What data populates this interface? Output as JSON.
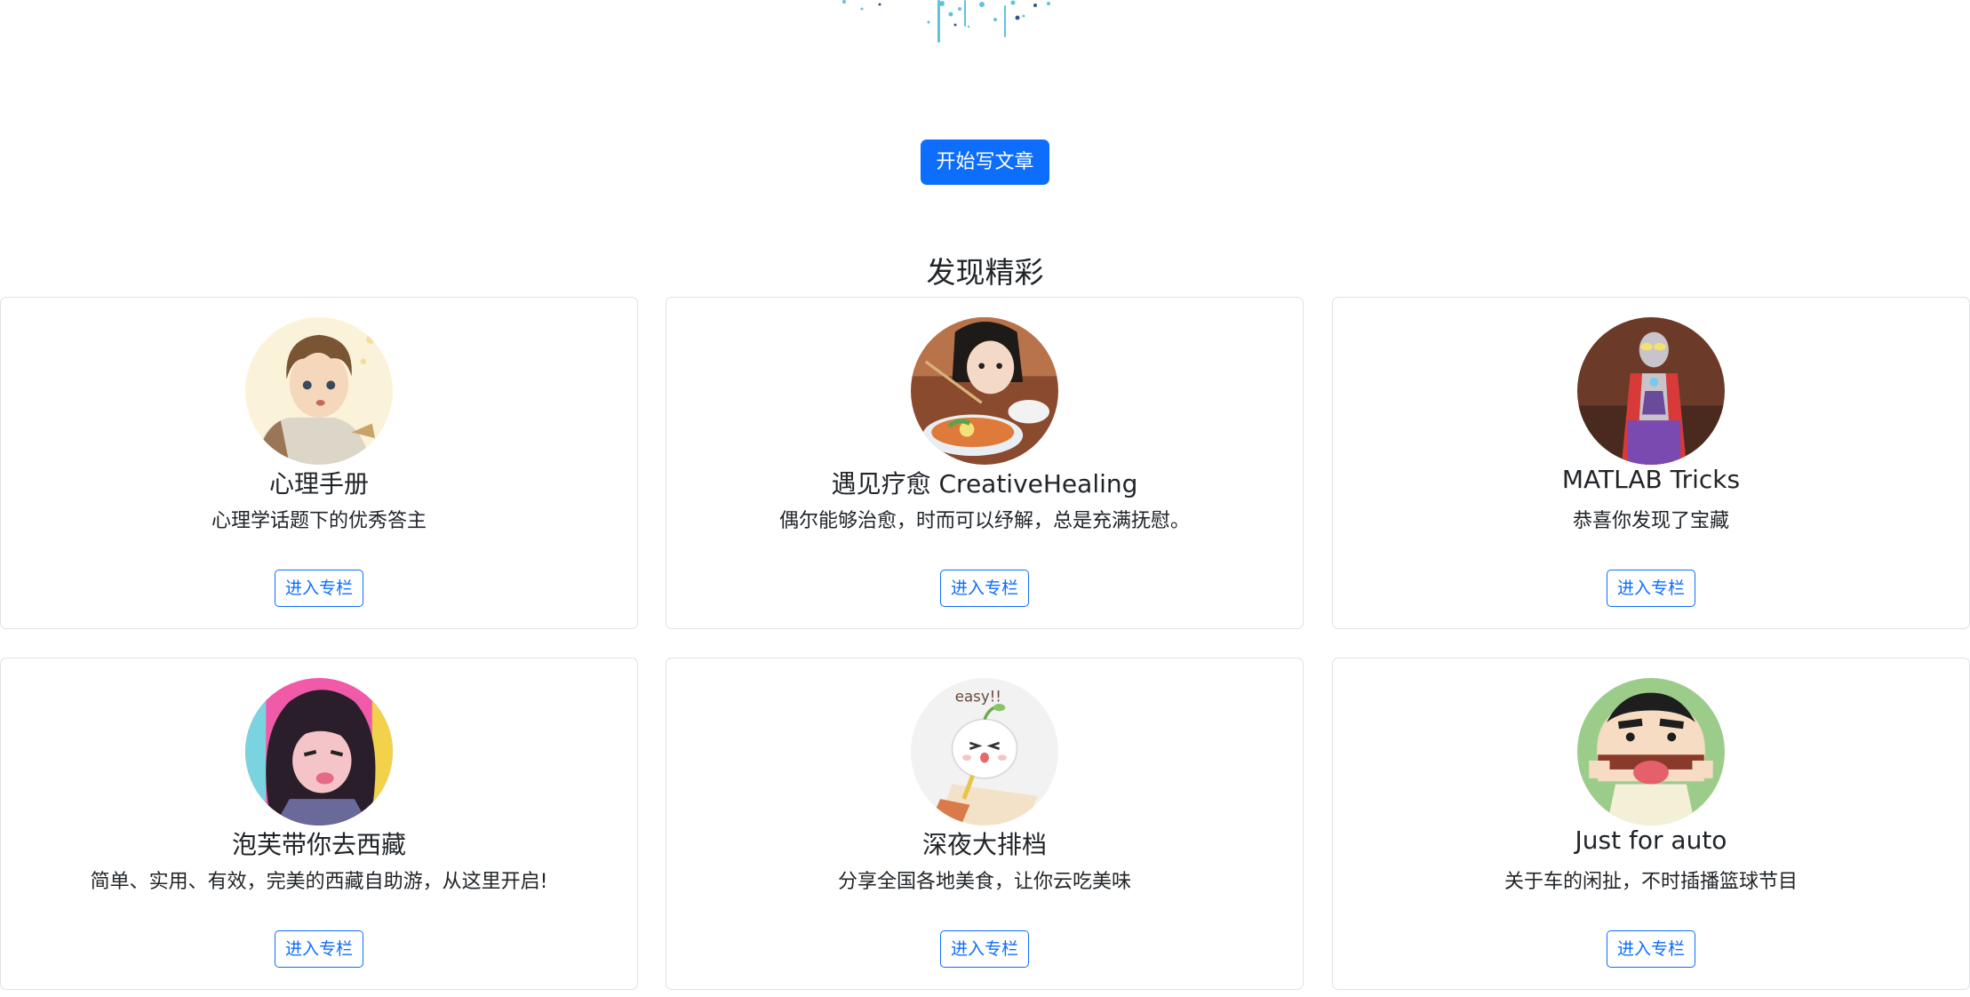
{
  "header": {
    "write_button_label": "开始写文章"
  },
  "section": {
    "title": "发现精彩"
  },
  "colors": {
    "primary": "#0d6efd",
    "card_border": "#dfe1e4",
    "text": "#212529"
  },
  "columns": [
    {
      "title": "心理手册",
      "description": "心理学话题下的优秀答主",
      "button_label": "进入专栏",
      "avatar": "anime-boy-avatar"
    },
    {
      "title": "遇见疗愈 CreativeHealing",
      "description": "偶尔能够治愈，时而可以纾解，总是充满抚慰。",
      "button_label": "进入专栏",
      "avatar": "girl-with-noodles-avatar"
    },
    {
      "title": "MATLAB Tricks",
      "description": "恭喜你发现了宝藏",
      "button_label": "进入专栏",
      "avatar": "ultraman-avatar"
    },
    {
      "title": "泡芙带你去西藏",
      "description": "简单、实用、有效，完美的西藏自助游，从这里开启!",
      "button_label": "进入专栏",
      "avatar": "cartoon-girl-avatar"
    },
    {
      "title": "深夜大排档",
      "description": "分享全国各地美食，让你云吃美味",
      "button_label": "进入专栏",
      "avatar": "cute-bun-avatar"
    },
    {
      "title": "Just for auto",
      "description": "关于车的闲扯，不时插播篮球节目",
      "button_label": "进入专栏",
      "avatar": "crayon-shinchan-avatar"
    }
  ]
}
